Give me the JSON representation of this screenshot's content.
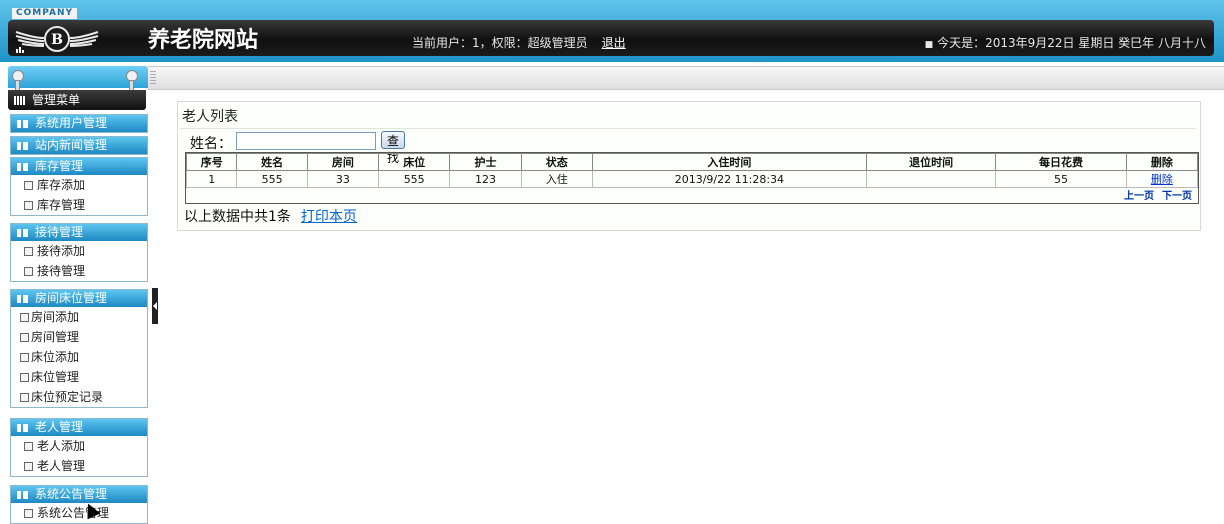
{
  "header": {
    "company_tag": "COMPANY",
    "site_title": "养老院网站",
    "user_info": "当前用户：1，权限：超级管理员",
    "logout_label": "退出",
    "date_info": "今天是：2013年9月22日 星期日 癸巳年 八月十八",
    "brand_color": "#1f93c8"
  },
  "sidebar": {
    "menu_title": "管理菜单",
    "groups": [
      {
        "title": "系统用户管理",
        "items": []
      },
      {
        "title": "站内新闻管理",
        "items": []
      },
      {
        "title": "库存管理",
        "items": [
          {
            "label": "库存添加"
          },
          {
            "label": "库存管理"
          }
        ]
      },
      {
        "title": "接待管理",
        "items": [
          {
            "label": "接待添加"
          },
          {
            "label": "接待管理"
          }
        ]
      },
      {
        "title": "房间床位管理",
        "items": [
          {
            "label": "房间添加"
          },
          {
            "label": "房间管理"
          },
          {
            "label": "床位添加"
          },
          {
            "label": "床位管理"
          },
          {
            "label": "床位预定记录"
          }
        ]
      },
      {
        "title": "老人管理",
        "items": [
          {
            "label": "老人添加"
          },
          {
            "label": "老人管理"
          }
        ]
      },
      {
        "title": "系统公告管理",
        "items": [
          {
            "label": "系统公告管理"
          }
        ]
      }
    ]
  },
  "main": {
    "panel_title": "老人列表",
    "search": {
      "label": "姓名：",
      "value": "",
      "placeholder": "",
      "button_label": "查找"
    },
    "table": {
      "columns": [
        "序号",
        "姓名",
        "房间",
        "床位",
        "护士",
        "状态",
        "入住时间",
        "退位时间",
        "每日花费",
        "删除"
      ],
      "rows": [
        {
          "cells": [
            "1",
            "555",
            "33",
            "555",
            "123",
            "入住",
            "2013/9/22 11:28:34",
            "",
            "55"
          ],
          "delete_label": "删除"
        }
      ]
    },
    "pager": {
      "prev_label": "上一页",
      "next_label": "下一页"
    },
    "summary": "以上数据中共1条",
    "print_label": "打印本页"
  }
}
